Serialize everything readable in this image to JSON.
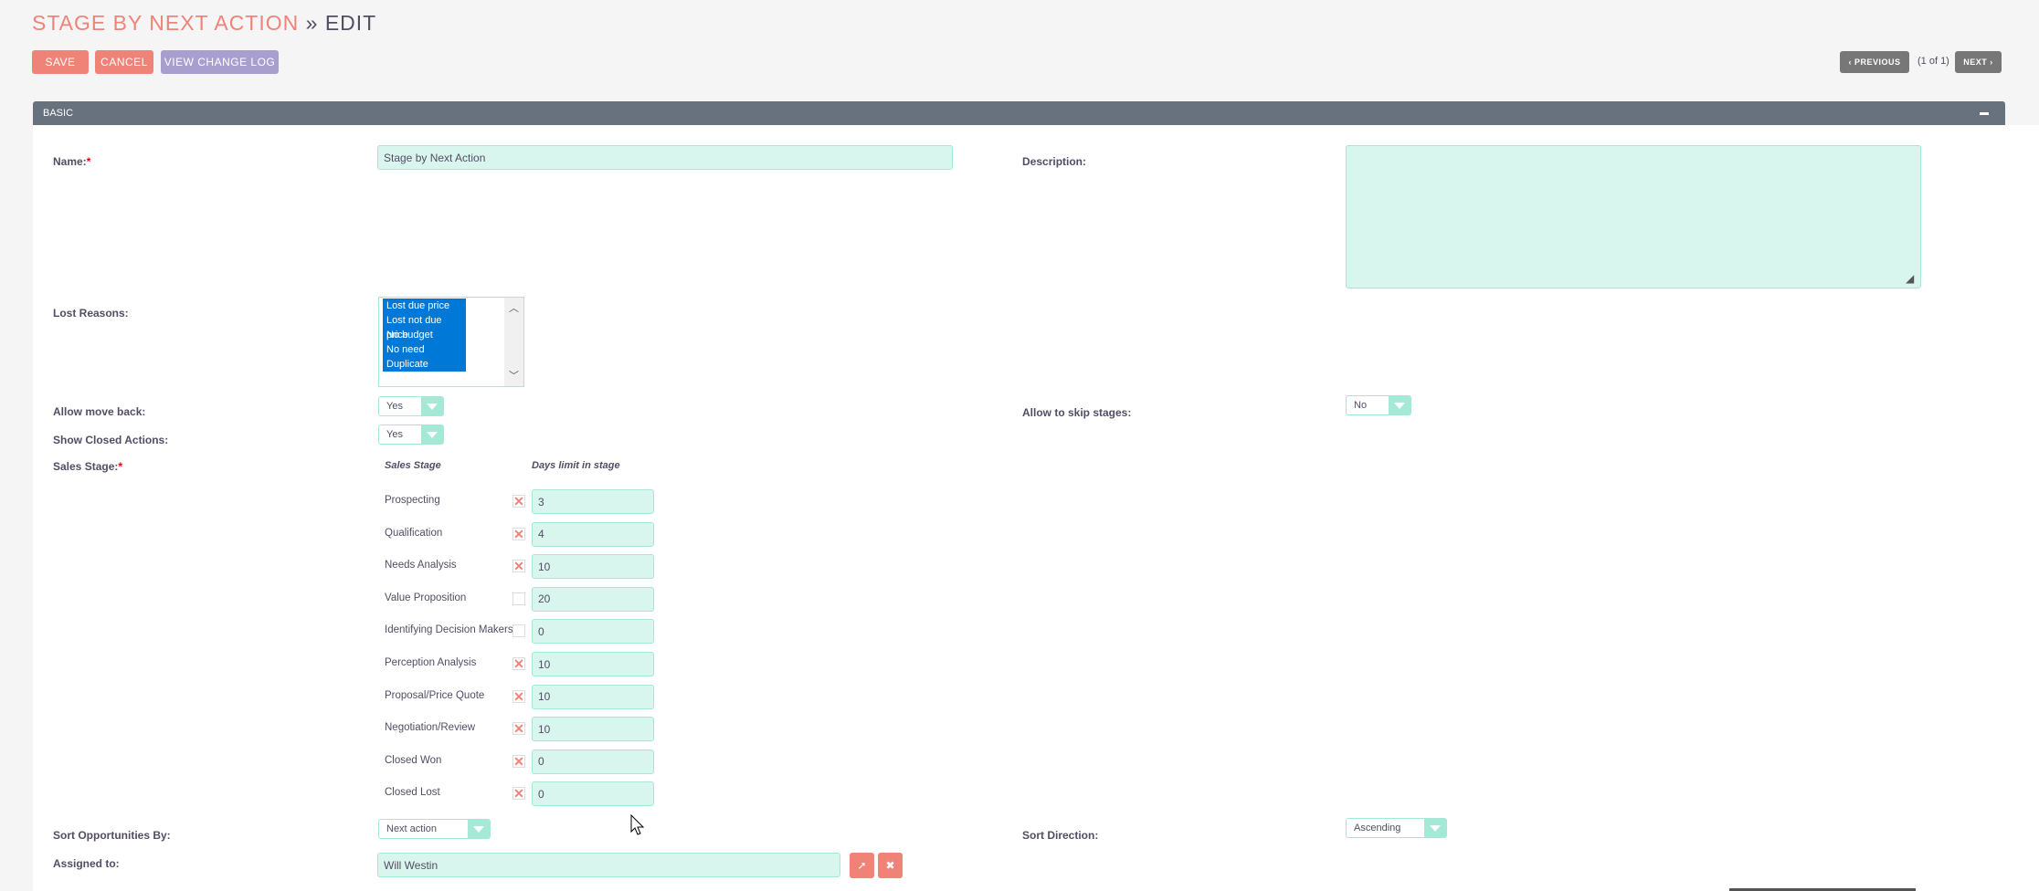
{
  "header": {
    "module": "STAGE BY NEXT ACTION",
    "separator": "»",
    "action": "EDIT"
  },
  "toolbar": {
    "save": "SAVE",
    "cancel": "CANCEL",
    "change_log": "VIEW CHANGE LOG"
  },
  "pagination": {
    "previous": "PREVIOUS",
    "count": "(1 of 1)",
    "next": "NEXT"
  },
  "panel": {
    "title": "BASIC"
  },
  "fields": {
    "name": {
      "label": "Name:",
      "required": "*",
      "value": "Stage by Next Action"
    },
    "description": {
      "label": "Description:",
      "value": ""
    },
    "lost_reasons": {
      "label": "Lost Reasons:",
      "options": [
        "Lost due price",
        "Lost not due price",
        "No budget",
        "No need",
        "Duplicate"
      ]
    },
    "allow_move_back": {
      "label": "Allow move back:",
      "value": "Yes"
    },
    "show_closed_actions": {
      "label": "Show Closed Actions:",
      "value": "Yes"
    },
    "allow_skip_stages": {
      "label": "Allow to skip stages:",
      "value": "No"
    },
    "sales_stage": {
      "label": "Sales Stage:",
      "required": "*",
      "col_stage": "Sales Stage",
      "col_days": "Days limit in stage",
      "rows": [
        {
          "stage": "Prospecting",
          "checked": true,
          "days": "3"
        },
        {
          "stage": "Qualification",
          "checked": true,
          "days": "4"
        },
        {
          "stage": "Needs Analysis",
          "checked": true,
          "days": "10"
        },
        {
          "stage": "Value Proposition",
          "checked": false,
          "days": "20"
        },
        {
          "stage": "Identifying Decision Makers",
          "checked": false,
          "days": "0"
        },
        {
          "stage": "Perception Analysis",
          "checked": true,
          "days": "10"
        },
        {
          "stage": "Proposal/Price Quote",
          "checked": true,
          "days": "10"
        },
        {
          "stage": "Negotiation/Review",
          "checked": true,
          "days": "10"
        },
        {
          "stage": "Closed Won",
          "checked": true,
          "days": "0"
        },
        {
          "stage": "Closed Lost",
          "checked": true,
          "days": "0"
        }
      ]
    },
    "sort_by": {
      "label": "Sort Opportunities By:",
      "value": "Next action"
    },
    "sort_direction": {
      "label": "Sort Direction:",
      "value": "Ascending"
    },
    "assigned_to": {
      "label": "Assigned to:",
      "value": "Will Westin"
    }
  },
  "colors": {
    "accent": "#f08377",
    "field_bg": "#d8f5ee",
    "field_border": "#a5e8d6",
    "panel_header": "#67727e",
    "selection": "#0078d7"
  }
}
